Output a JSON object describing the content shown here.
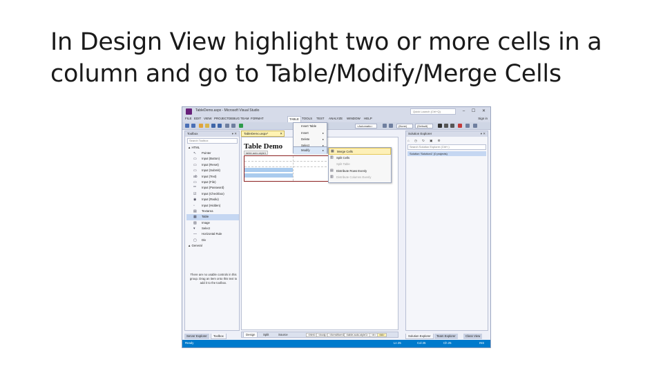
{
  "slide": {
    "title_line1": "In Design View highlight two or more cells in a",
    "title_line2": "column and go to Table/Modify/Merge Cells"
  },
  "window": {
    "title": "TableDemo.aspx - Microsoft Visual Studio",
    "quick_launch": "Quick Launch (Ctrl+Q)",
    "controls": "– ☐ ✕"
  },
  "menubar": {
    "items": [
      "FILE",
      "EDIT",
      "VIEW",
      "PROJECT",
      "DEBUG",
      "TEAM",
      "FORMAT",
      "TABLE",
      "TOOLS",
      "TEST",
      "ANALYZE",
      "WINDOW",
      "HELP"
    ],
    "sign_in": "Sign in"
  },
  "toolbar": {
    "target": "<Automatic>",
    "style": "(None)",
    "font": "(Default)"
  },
  "toolbox": {
    "header": "Toolbox",
    "search_placeholder": "Search Toolbox",
    "group_html": "▲ HTML",
    "items": [
      {
        "label": "Pointer",
        "glyph": "↖"
      },
      {
        "label": "Input (Button)",
        "glyph": "▭"
      },
      {
        "label": "Input (Reset)",
        "glyph": "▭"
      },
      {
        "label": "Input (Submit)",
        "glyph": "▭"
      },
      {
        "label": "Input (Text)",
        "glyph": "ab"
      },
      {
        "label": "Input (File)",
        "glyph": "▭"
      },
      {
        "label": "Input (Password)",
        "glyph": "**"
      },
      {
        "label": "Input (Checkbox)",
        "glyph": "☑"
      },
      {
        "label": "Input (Radio)",
        "glyph": "◉"
      },
      {
        "label": "Input (Hidden)",
        "glyph": "▫"
      },
      {
        "label": "Textarea",
        "glyph": "▤"
      },
      {
        "label": "Table",
        "glyph": "▦"
      },
      {
        "label": "Image",
        "glyph": "▨"
      },
      {
        "label": "Select",
        "glyph": "▾"
      },
      {
        "label": "Horizontal Rule",
        "glyph": "—"
      },
      {
        "label": "Div",
        "glyph": "▢"
      }
    ],
    "group_general": "▲ General",
    "empty_message": "There are no usable controls in this group. Drag an item onto this text to add it to the toolbox."
  },
  "bottom_tabs_left": [
    "Server Explorer",
    "Toolbox"
  ],
  "document": {
    "tab_label": "TableDemo.aspx*",
    "heading": "Table Demo",
    "table_tag": "table.auto-style1"
  },
  "view_tabs": [
    "Design",
    "Split",
    "Source"
  ],
  "breadcrumbs": [
    "<html>",
    "<body>",
    "<form#form1>",
    "<table.auto-style1>",
    "<tr>",
    "<td>"
  ],
  "table_menu": [
    "Insert Table",
    "Insert",
    "Delete",
    "Select",
    "Modify"
  ],
  "modify_menu": [
    {
      "label": "Merge Cells",
      "state": "highlighted"
    },
    {
      "label": "Split Cells",
      "state": "normal"
    },
    {
      "label": "Split Table",
      "state": "disabled"
    },
    {
      "label": "Distribute Rows Evenly",
      "state": "normal"
    },
    {
      "label": "Distribute Columns Evenly",
      "state": "disabled"
    },
    {
      "label": "AutoFit to Contents",
      "state": "disabled"
    }
  ],
  "solution_explorer": {
    "header": "Solution Explorer",
    "search_placeholder": "Search Solution Explorer (Ctrl+;)",
    "root_item": "Solution 'Solution1' (0 projects)"
  },
  "bottom_tabs_right": [
    "Solution Explorer",
    "Team Explorer",
    "Class View"
  ],
  "status": {
    "ready": "Ready",
    "ln": "Ln 25",
    "col": "Col 25",
    "ch": "Ch 25",
    "mode": "INS"
  }
}
